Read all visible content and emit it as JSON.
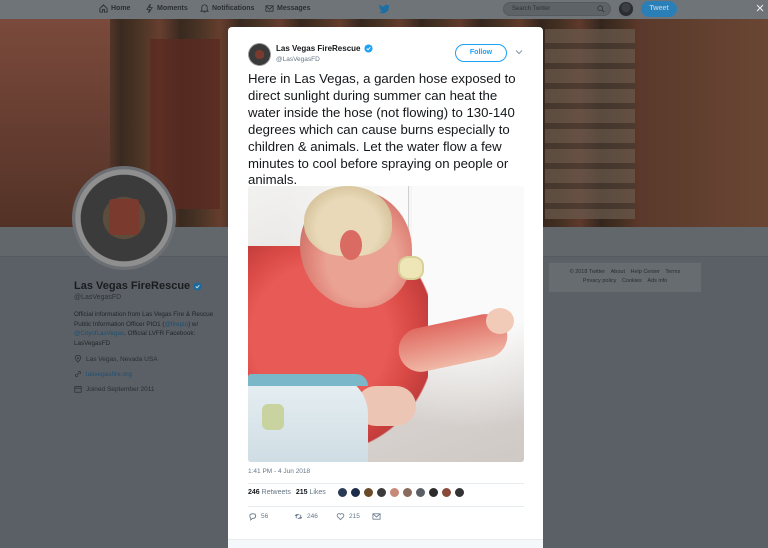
{
  "nav": {
    "home": "Home",
    "moments": "Moments",
    "notifications": "Notifications",
    "messages": "Messages",
    "search_placeholder": "Search Twitter",
    "tweet_button": "Tweet",
    "close": "×"
  },
  "profile": {
    "name": "Las Vegas FireRescue",
    "handle": "@LasVegasFD",
    "bio_1": "Official information from Las Vegas Fire & Rescue Public Information Officer PIO1 (",
    "bio_link1": "@firepio",
    "bio_2": ") w/ ",
    "bio_link2": "@CityofLasVegas",
    "bio_3": ". Official LVFR Facebook: LasVegasFD",
    "location": "Las Vegas, Nevada USA",
    "website": "lasvegasfire.org",
    "joined": "Joined September 2011"
  },
  "footer": {
    "copyright": "© 2018 Twitter",
    "about": "About",
    "help": "Help Center",
    "terms": "Terms",
    "privacy": "Privacy policy",
    "cookies": "Cookies",
    "ads": "Ads info"
  },
  "tweet": {
    "author_name": "Las Vegas FireRescue",
    "author_handle": "@LasVegasFD",
    "follow_label": "Follow",
    "text": "Here in Las Vegas, a garden hose exposed to direct sunlight during summer can heat the water inside the hose (not flowing) to 130-140 degrees which can cause burns especially to children & animals. Let the water flow a few minutes to cool before spraying on people or animals.",
    "timestamp": "1:41 PM - 4 Jun 2018",
    "retweets_count": "246",
    "retweets_label": "Retweets",
    "likes_count": "215",
    "likes_label": "Likes",
    "reply_count": "56",
    "retweet_action_count": "246",
    "like_action_count": "215"
  },
  "colors": {
    "accent": "#1da1f2",
    "overlay_bg": "#5b6066",
    "liker_avatars": [
      "#2a3a55",
      "#1b2b4a",
      "#6a4a2a",
      "#3b3b3b",
      "#c78a7a",
      "#8a6a5a",
      "#5a5f66",
      "#2b2b2b",
      "#8a4a3a",
      "#333333"
    ]
  }
}
